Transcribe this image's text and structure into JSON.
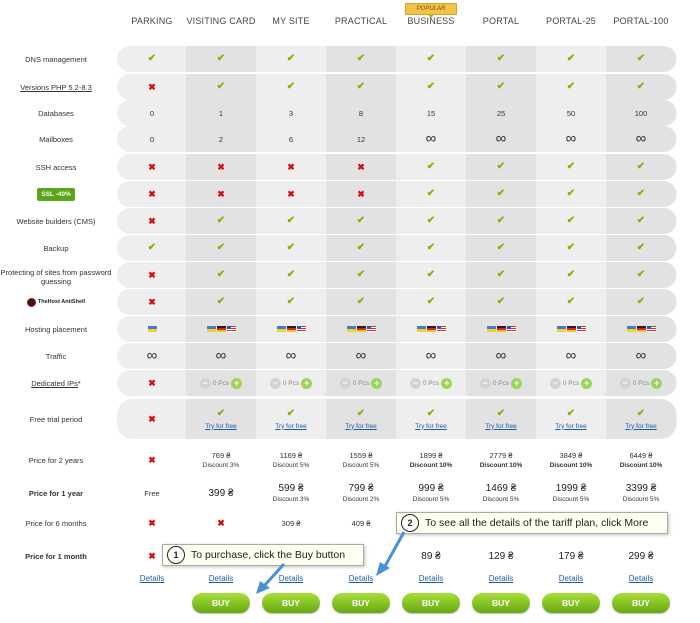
{
  "header": {
    "popular_badge": "POPULAR",
    "plans": [
      "PARKING",
      "VISITING CARD",
      "MY SITE",
      "PRACTICAL",
      "BUSINESS",
      "PORTAL",
      "PORTAL-25",
      "PORTAL-100"
    ]
  },
  "rows": {
    "dns": "DNS management",
    "php": "Versions PHP 5.2-8.3",
    "databases": "Databases",
    "mailboxes": "Mailboxes",
    "ssh": "SSH access",
    "ssl_badge": "SSL -40%",
    "builders": "Website builders (CMS)",
    "backup": "Backup",
    "protect": "Protecting of sites from password guessing",
    "antishell_badge": "TheHost AntiShell",
    "placement": "Hosting placement",
    "traffic": "Traffic",
    "ips": "Dedicated IPs",
    "ips_star": " *",
    "trial": "Free trial period",
    "p2y": "Price for 2 years",
    "p1y": "Price for 1 year",
    "p6m": "Price for 6 months",
    "p1m": "Price for 1 month"
  },
  "values": {
    "databases": [
      "0",
      "1",
      "3",
      "8",
      "15",
      "25",
      "50",
      "100"
    ],
    "mailboxes": [
      "0",
      "2",
      "6",
      "12"
    ],
    "ips_pcs": "0 Pcs",
    "try_free": "Try for free",
    "p2y": [
      "769 ₴",
      "1169 ₴",
      "1559 ₴",
      "1899 ₴",
      "2779 ₴",
      "3849 ₴",
      "6449 ₴"
    ],
    "p2y_disc": [
      "Discount 3%",
      "Discount 5%",
      "Discount 5%",
      "Discount 10%",
      "Discount 10%",
      "Discount 10%",
      "Discount 10%"
    ],
    "p1y_parking": "Free",
    "p1y": [
      "399 ₴",
      "599 ₴",
      "799 ₴",
      "999 ₴",
      "1469 ₴",
      "1999 ₴",
      "3399 ₴"
    ],
    "p1y_disc": [
      "Discount 3%",
      "Discount 2%",
      "Discount 5%",
      "Discount 5%",
      "Discount 5%",
      "Discount 5%"
    ],
    "p6m": [
      "309 ₴",
      "409 ₴"
    ],
    "p1m": [
      "89 ₴",
      "129 ₴",
      "179 ₴",
      "299 ₴"
    ]
  },
  "actions": {
    "details": "Details",
    "buy": "BUY"
  },
  "callouts": {
    "one_num": "1",
    "one_text": "To purchase, click the Buy button",
    "two_num": "2",
    "two_text": "To see all the details of the tariff plan, click More"
  },
  "colors": {
    "check": "#7cb800",
    "cross": "#d01010",
    "buy": "#8cc528",
    "link": "#1a5ea8"
  }
}
